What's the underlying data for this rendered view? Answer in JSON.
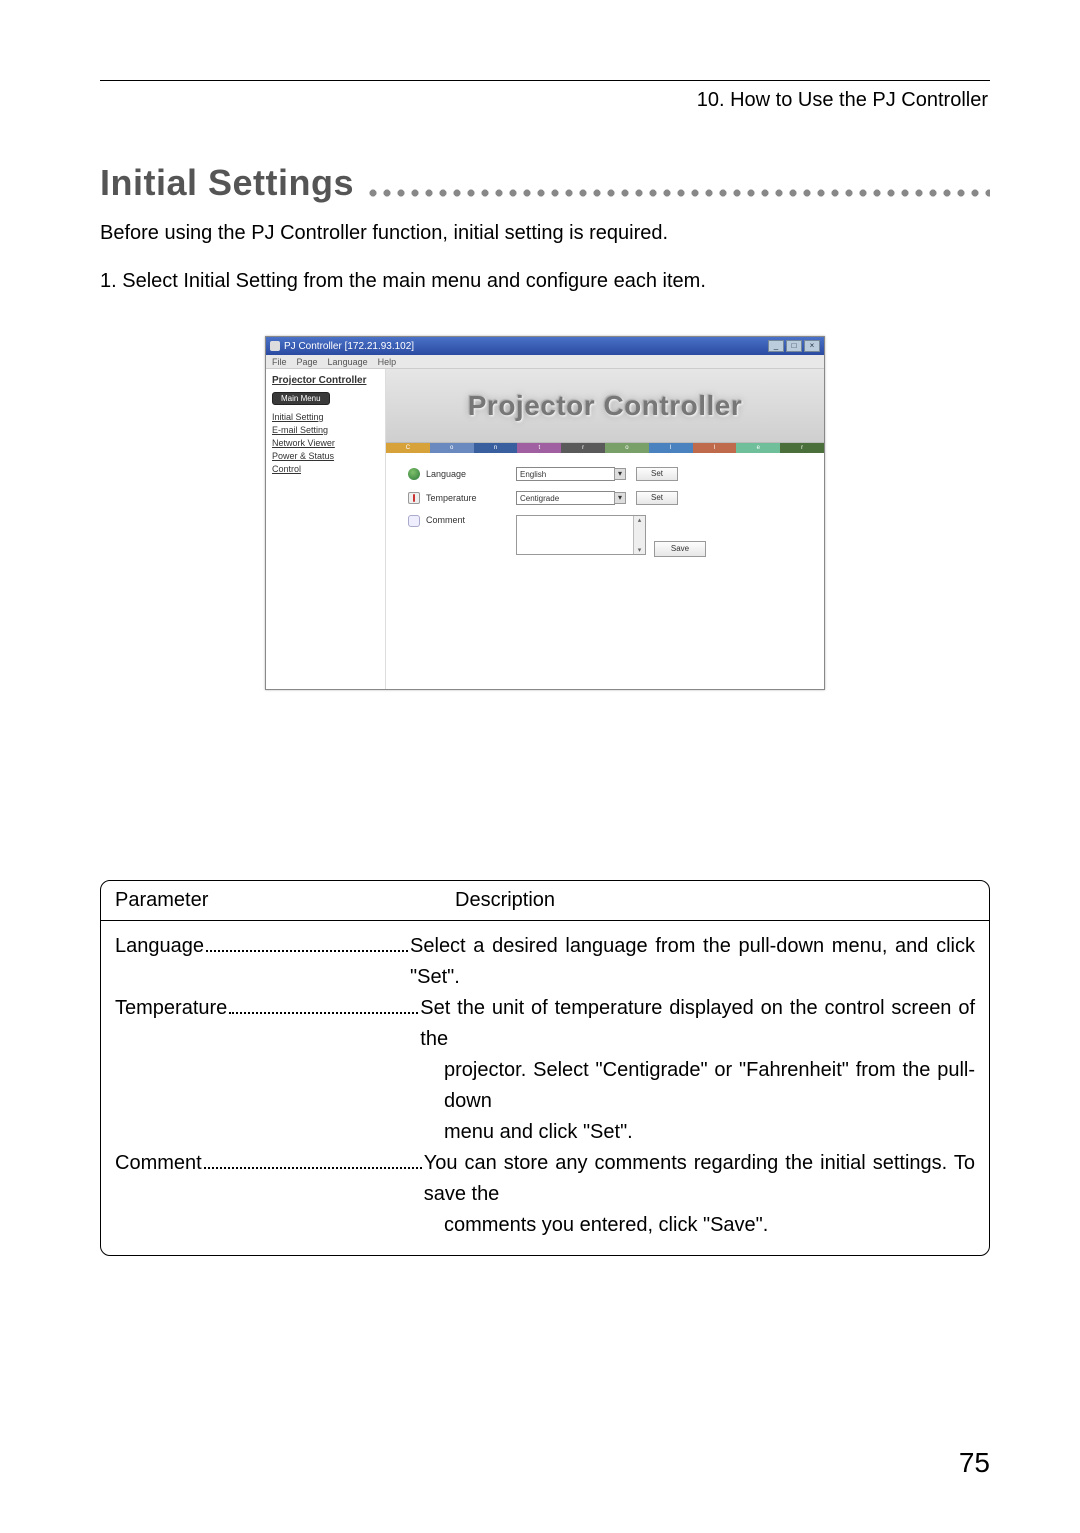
{
  "chapter": "10. How to Use the PJ Controller",
  "heading": "Initial Settings",
  "intro": "Before using the PJ Controller function, initial setting is required.",
  "step1": "1. Select Initial Setting from the main menu and configure each item.",
  "page_number": "75",
  "window": {
    "title": "PJ Controller [172.21.93.102]",
    "menu": {
      "m1": "File",
      "m2": "Page",
      "m3": "Language",
      "m4": "Help"
    },
    "winbtns": {
      "min": "_",
      "max": "□",
      "close": "×"
    },
    "sidebar": {
      "title": "Projector Controller",
      "main_menu_btn": "Main Menu",
      "links": {
        "l1": "Initial Setting",
        "l2": "E-mail Setting",
        "l3": "Network Viewer",
        "l4": "Power & Status",
        "l5": "Control"
      }
    },
    "banner": "Projector Controller",
    "colorbar": {
      "c1": "C",
      "c2": "o",
      "c3": "n",
      "c4": "t",
      "c5": "r",
      "c6": "o",
      "c7": "l",
      "c8": "l",
      "c9": "e",
      "c10": "r"
    },
    "rows": {
      "lang_label": "Language",
      "lang_value": "English",
      "temp_label": "Temperature",
      "temp_value": "Centigrade",
      "comment_label": "Comment",
      "set_btn": "Set",
      "save_btn": "Save"
    }
  },
  "table": {
    "h1": "Parameter",
    "h2": "Description",
    "p1_name": "Language",
    "p1_desc": "Select a desired language from the pull-down menu, and click \"Set\".",
    "p2_name": "Temperature",
    "p2_desc_a": "Set the unit of temperature displayed on the control screen of the",
    "p2_desc_b": "projector. Select \"Centigrade\" or \"Fahrenheit\" from the pull-down",
    "p2_desc_c": "menu and click \"Set\".",
    "p3_name": "Comment",
    "p3_desc_a": "You can store any comments regarding the initial settings. To save the",
    "p3_desc_b": "comments you entered, click \"Save\"."
  }
}
